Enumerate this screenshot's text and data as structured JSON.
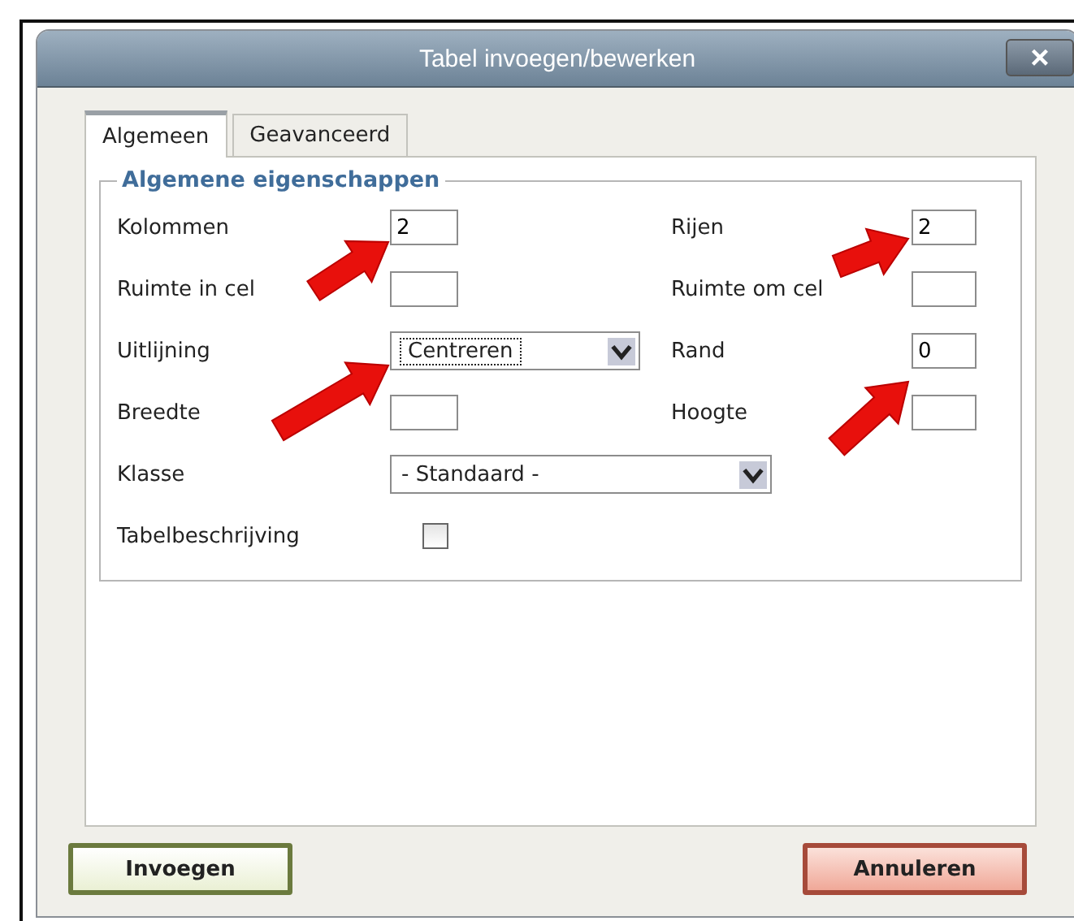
{
  "window": {
    "title": "Tabel invoegen/bewerken",
    "close": "×"
  },
  "tabs": [
    {
      "label": "Algemeen",
      "selected": true
    },
    {
      "label": "Geavanceerd",
      "selected": false
    }
  ],
  "fieldset": {
    "legend": "Algemene eigenschappen"
  },
  "fields": [
    {
      "label": "Kolommen",
      "kind": "text",
      "value": "2"
    },
    {
      "label": "Rijen",
      "kind": "text",
      "value": "2"
    },
    {
      "label": "Ruimte in cel",
      "kind": "text"
    },
    {
      "label": "Ruimte om cel",
      "kind": "text"
    },
    {
      "label": "Uitlijning",
      "kind": "select",
      "value": "Centreren"
    },
    {
      "label": "Rand",
      "kind": "text",
      "value": "0"
    },
    {
      "label": "Breedte",
      "kind": "text"
    },
    {
      "label": "Hoogte",
      "kind": "text"
    },
    {
      "label": "Klasse",
      "kind": "select",
      "value": "- Standaard -",
      "wide": true
    },
    {
      "label": "Tabelbeschrijving",
      "kind": "checkbox",
      "checked": false
    }
  ],
  "buttons": [
    {
      "label": "Invoegen",
      "kind": "primary"
    },
    {
      "label": "Annuleren",
      "kind": "cancel"
    }
  ]
}
